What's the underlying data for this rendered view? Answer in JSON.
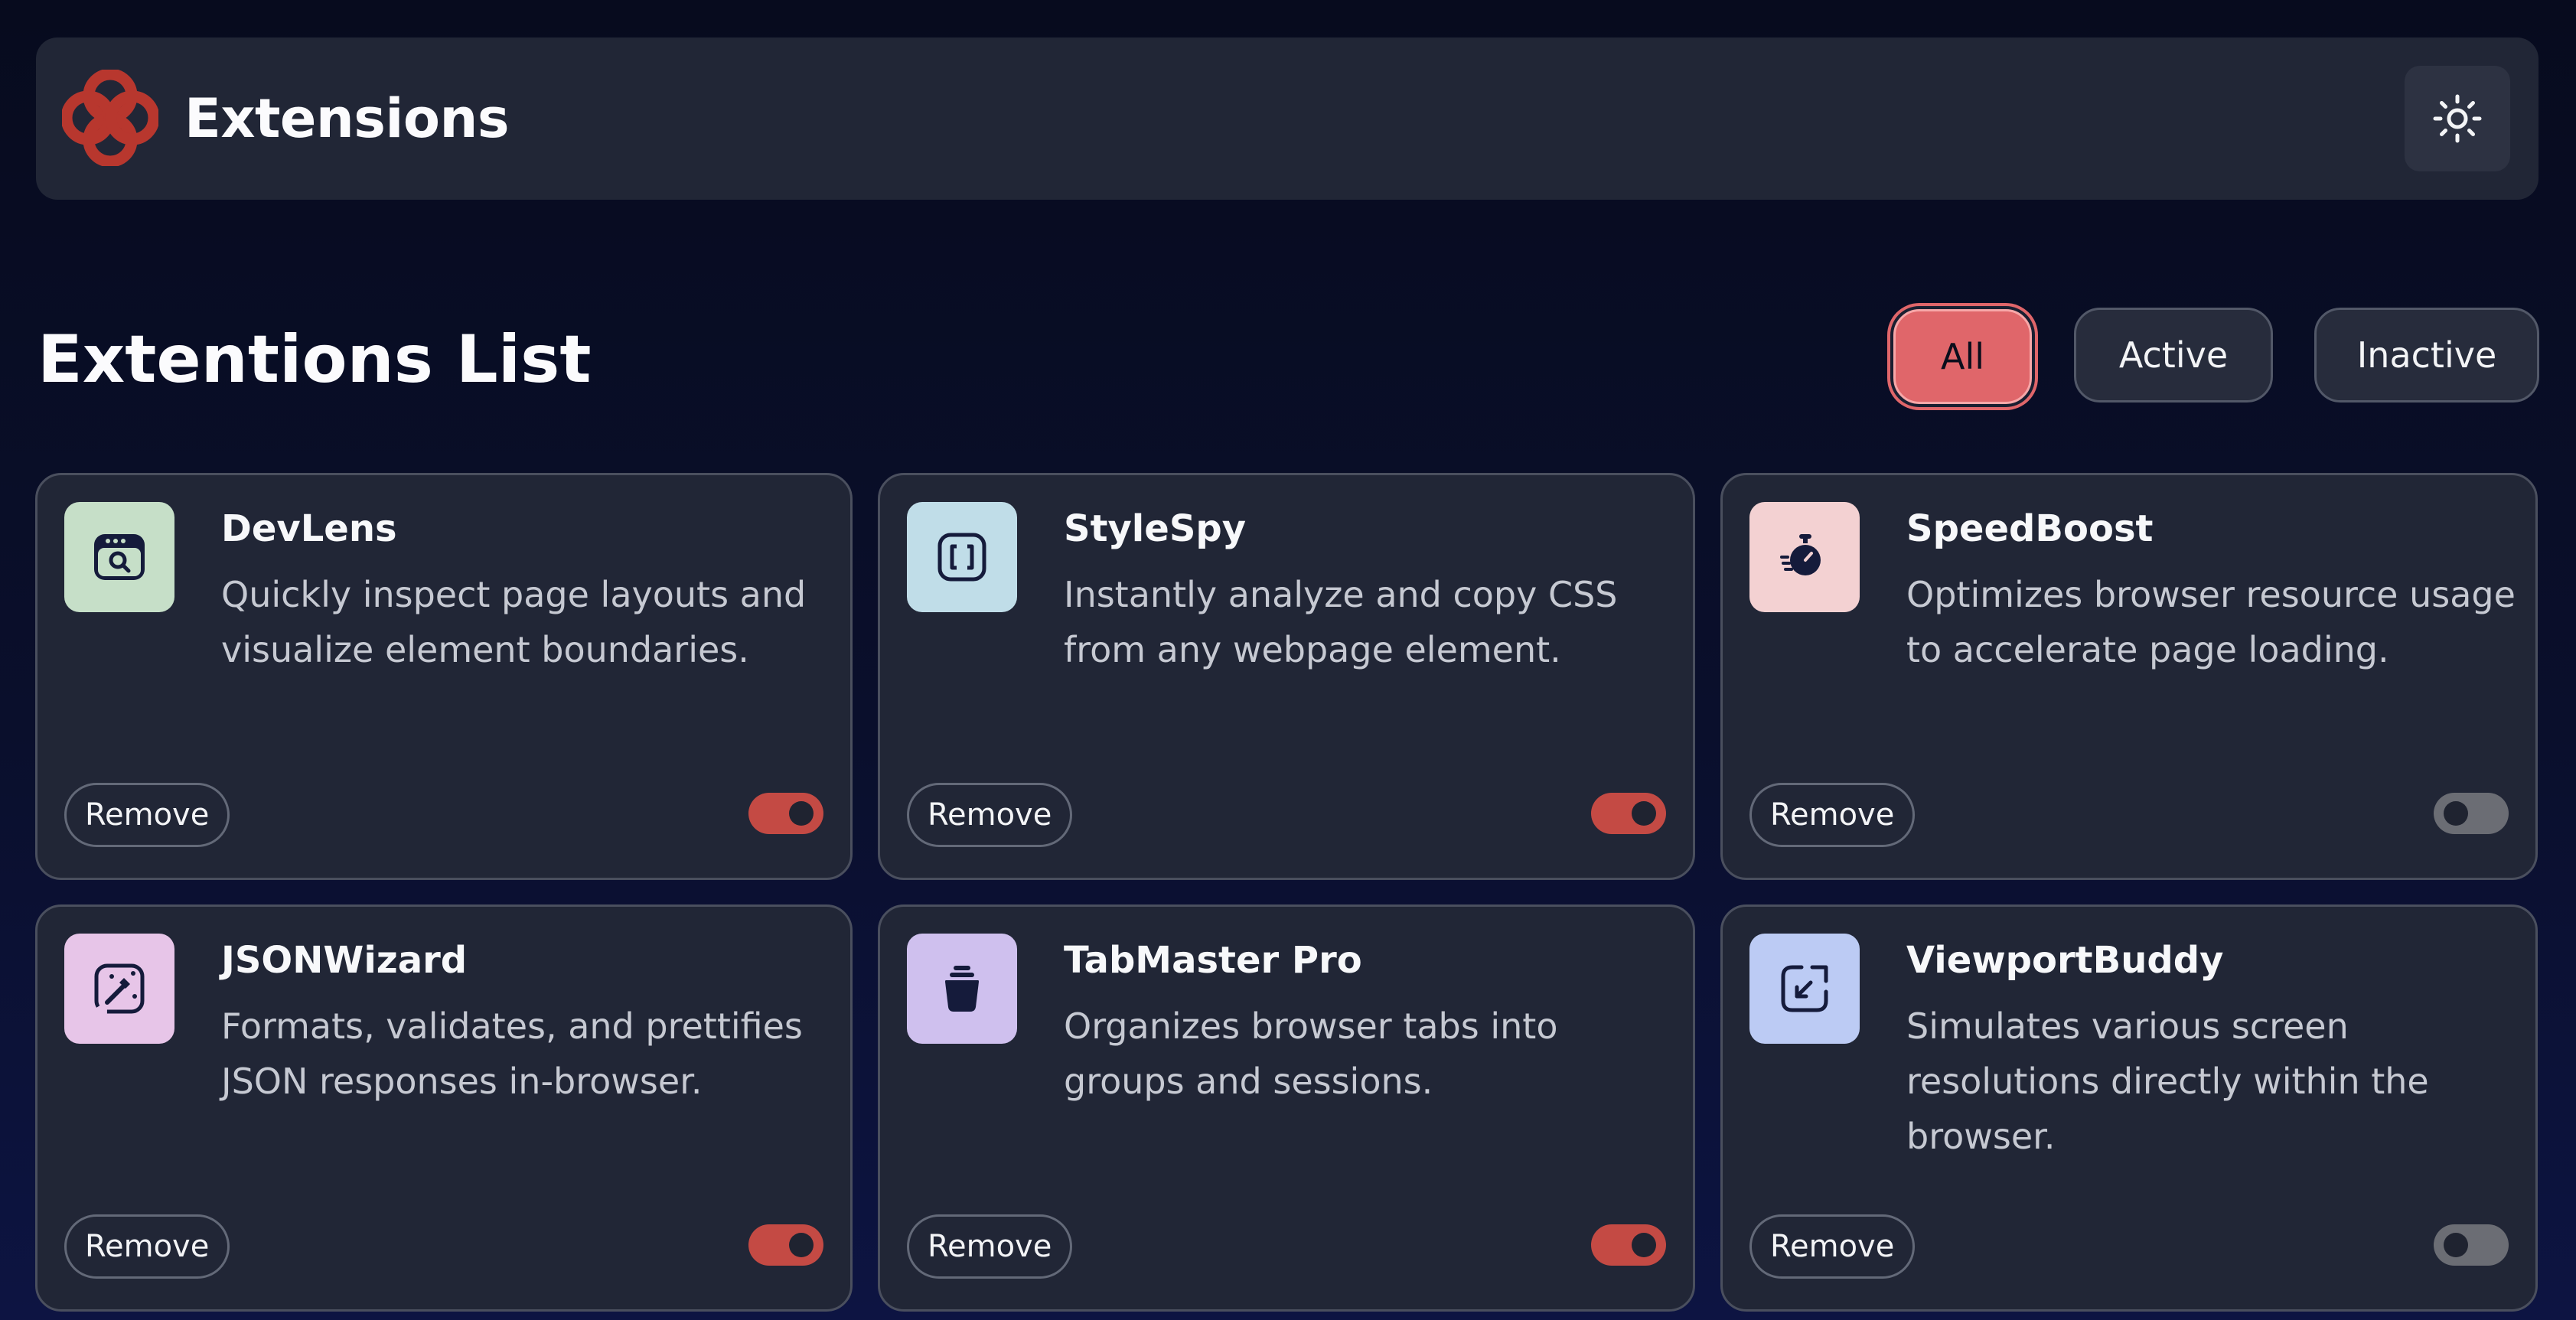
{
  "header": {
    "brand": "Extensions",
    "logo_icon": "red-interlocking-loops-logo",
    "theme_toggle_icon": "sun-icon"
  },
  "main": {
    "title": "Extentions List",
    "filters": [
      {
        "label": "All",
        "selected": true
      },
      {
        "label": "Active",
        "selected": false
      },
      {
        "label": "Inactive",
        "selected": false
      }
    ]
  },
  "extensions": [
    {
      "name": "DevLens",
      "description": "Quickly inspect page layouts and visualize element boundaries.",
      "icon": "browser-search-icon",
      "icon_bg": "#c6dfc8",
      "remove_label": "Remove",
      "active": true
    },
    {
      "name": "StyleSpy",
      "description": "Instantly analyze and copy CSS from any webpage element.",
      "icon": "brackets-icon",
      "icon_bg": "#c0dde8",
      "remove_label": "Remove",
      "active": true
    },
    {
      "name": "SpeedBoost",
      "description": "Optimizes browser resource usage to accelerate page loading.",
      "icon": "stopwatch-icon",
      "icon_bg": "#f3d1d2",
      "remove_label": "Remove",
      "active": false
    },
    {
      "name": "JSONWizard",
      "description": "Formats, validates, and prettifies JSON responses in-browser.",
      "icon": "magic-wand-icon",
      "icon_bg": "#e7c5e8",
      "remove_label": "Remove",
      "active": true
    },
    {
      "name": "TabMaster Pro",
      "description": "Organizes browser tabs into groups and sessions.",
      "icon": "jar-icon",
      "icon_bg": "#cfc0ee",
      "remove_label": "Remove",
      "active": true
    },
    {
      "name": "ViewportBuddy",
      "description": "Simulates various screen resolutions directly within the browser.",
      "icon": "resize-arrow-icon",
      "icon_bg": "#bccbf4",
      "remove_label": "Remove",
      "active": false
    }
  ],
  "colors": {
    "accent": "#c44a44",
    "accent_light": "#e0666a",
    "card_bg": "#212636",
    "page_bg": "#070b1e",
    "icon_ink": "#151b3b"
  }
}
